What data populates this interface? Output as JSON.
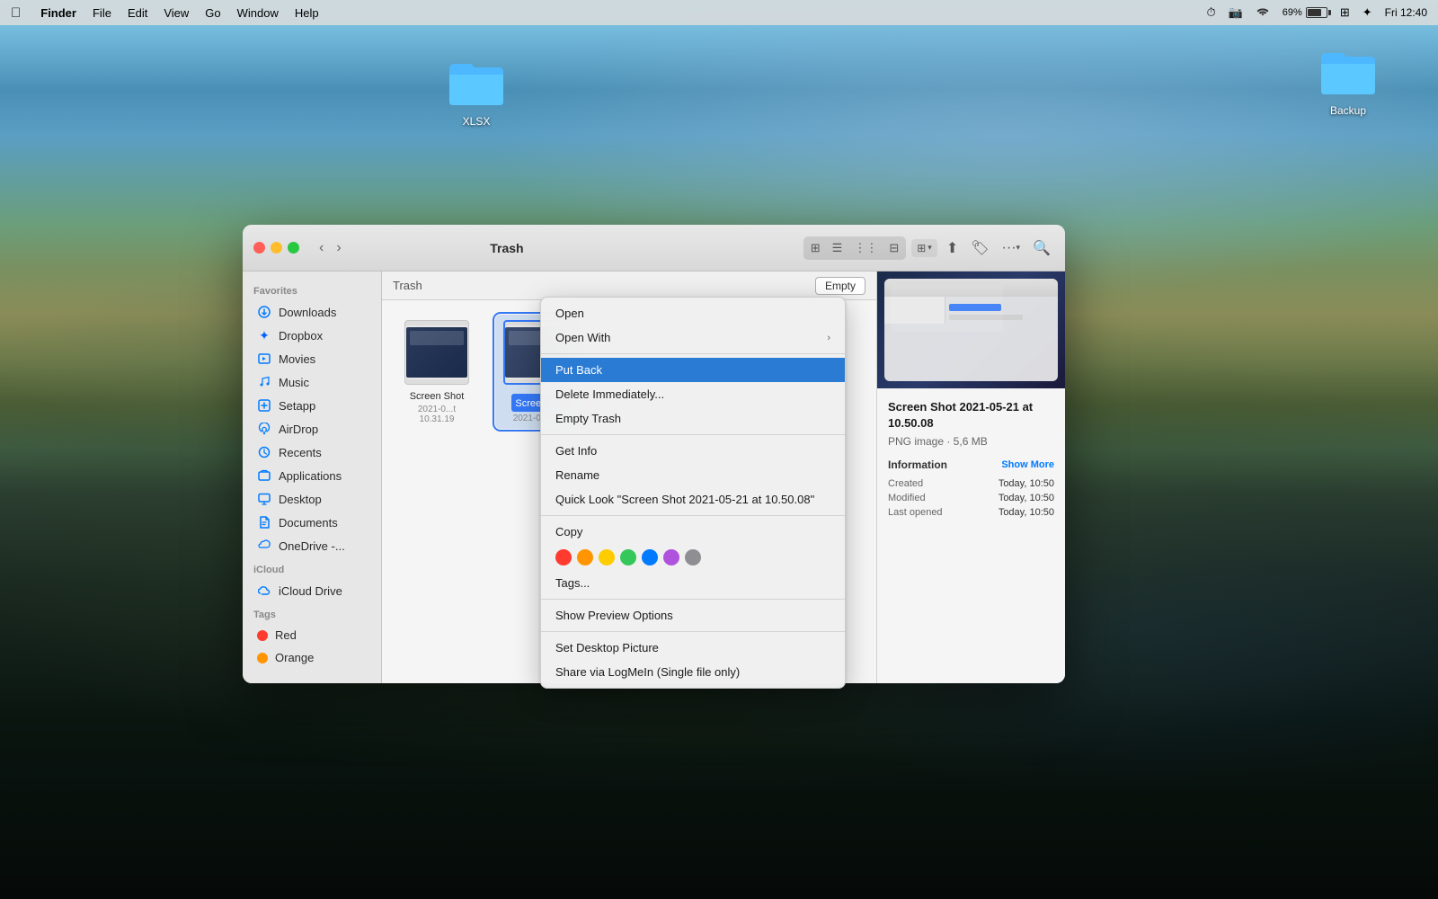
{
  "menubar": {
    "apple": "⌘",
    "finder": "Finder",
    "file": "File",
    "edit": "Edit",
    "view": "View",
    "go": "Go",
    "window": "Window",
    "help": "Help",
    "time": "Fri 12:40",
    "battery": "69%",
    "wifi": "WiFi"
  },
  "desktop": {
    "xlsx_label": "XLSX",
    "backup_label": "Backup"
  },
  "finder": {
    "title": "Trash",
    "breadcrumb": "Trash",
    "empty_button": "Empty",
    "sidebar": {
      "favorites_label": "Favorites",
      "items": [
        {
          "id": "downloads",
          "label": "Downloads",
          "icon": "⬇"
        },
        {
          "id": "dropbox",
          "label": "Dropbox",
          "icon": "📦"
        },
        {
          "id": "movies",
          "label": "Movies",
          "icon": "🎬"
        },
        {
          "id": "music",
          "label": "Music",
          "icon": "🎵"
        },
        {
          "id": "setapp",
          "label": "Setapp",
          "icon": "📱"
        },
        {
          "id": "airdrop",
          "label": "AirDrop",
          "icon": "📡"
        },
        {
          "id": "recents",
          "label": "Recents",
          "icon": "🕐"
        },
        {
          "id": "applications",
          "label": "Applications",
          "icon": "📂"
        },
        {
          "id": "desktop",
          "label": "Desktop",
          "icon": "🖥"
        },
        {
          "id": "documents",
          "label": "Documents",
          "icon": "📄"
        },
        {
          "id": "onedrive",
          "label": "OneDrive -...",
          "icon": "☁"
        }
      ],
      "icloud_label": "iCloud",
      "icloud_items": [
        {
          "id": "icloud-drive",
          "label": "iCloud Drive",
          "icon": "☁"
        }
      ],
      "tags_label": "Tags",
      "tags": [
        {
          "id": "red",
          "label": "Red",
          "color": "#ff3b30"
        },
        {
          "id": "orange",
          "label": "Orange",
          "color": "#ff9500"
        }
      ]
    },
    "files": [
      {
        "id": "screenshot1",
        "name": "Screen Shot",
        "date": "2021-0...t 10.31.19",
        "selected": false
      },
      {
        "id": "screenshot2",
        "name": "Screen S",
        "date": "2021-0...10",
        "selected": true
      }
    ],
    "preview": {
      "filename": "Screen Shot 2021-05-21 at 10.50.08",
      "filetype": "PNG image · 5,6 MB",
      "info_label": "Information",
      "show_more": "Show More",
      "created_key": "Created",
      "created_val": "Today, 10:50",
      "modified_key": "Modified",
      "modified_val": "Today, 10:50",
      "last_opened_key": "Last opened",
      "last_opened_val": "Today, 10:50"
    }
  },
  "context_menu": {
    "items": [
      {
        "id": "open",
        "label": "Open",
        "has_arrow": false,
        "separator_after": false
      },
      {
        "id": "open-with",
        "label": "Open With",
        "has_arrow": true,
        "separator_after": true
      },
      {
        "id": "put-back",
        "label": "Put Back",
        "has_arrow": false,
        "highlighted": true,
        "separator_after": false
      },
      {
        "id": "delete",
        "label": "Delete Immediately...",
        "has_arrow": false,
        "separator_after": false
      },
      {
        "id": "empty-trash",
        "label": "Empty Trash",
        "has_arrow": false,
        "separator_after": true
      },
      {
        "id": "get-info",
        "label": "Get Info",
        "has_arrow": false,
        "separator_after": false
      },
      {
        "id": "rename",
        "label": "Rename",
        "has_arrow": false,
        "separator_after": false
      },
      {
        "id": "quick-look",
        "label": "Quick Look \"Screen Shot 2021-05-21 at 10.50.08\"",
        "has_arrow": false,
        "separator_after": true
      },
      {
        "id": "copy",
        "label": "Copy",
        "has_arrow": false,
        "separator_after": false
      }
    ],
    "tags_label": "Tags...",
    "post_tag_items": [
      {
        "id": "show-preview",
        "label": "Show Preview Options",
        "has_arrow": false,
        "separator_after": true
      },
      {
        "id": "set-desktop",
        "label": "Set Desktop Picture",
        "has_arrow": false,
        "separator_after": false
      },
      {
        "id": "share-logmein",
        "label": "Share via LogMeIn (Single file only)",
        "has_arrow": false,
        "separator_after": false
      }
    ],
    "tag_colors": [
      {
        "id": "tag-red",
        "color": "#ff3b30"
      },
      {
        "id": "tag-orange",
        "color": "#ff9500"
      },
      {
        "id": "tag-yellow",
        "color": "#ffcc00"
      },
      {
        "id": "tag-green",
        "color": "#34c759"
      },
      {
        "id": "tag-blue",
        "color": "#007aff"
      },
      {
        "id": "tag-purple",
        "color": "#af52de"
      },
      {
        "id": "tag-gray",
        "color": "#8e8e93"
      }
    ]
  }
}
